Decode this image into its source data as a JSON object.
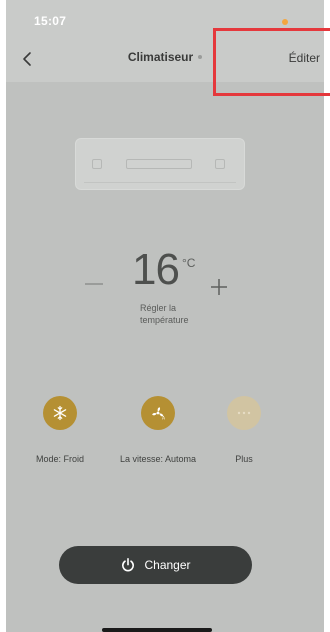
{
  "status_bar": {
    "time": "15:07"
  },
  "navbar": {
    "title": "Climatiseur",
    "edit_label": "Éditer",
    "back_icon": "chevron-left-icon"
  },
  "temperature": {
    "value": "16",
    "unit": "°C",
    "label_line1": "Régler la",
    "label_line2": "température"
  },
  "controls": [
    {
      "label": "Mode: Froid",
      "icon": "snowflake-icon"
    },
    {
      "label": "La vitesse: Automa",
      "icon": "fan-icon"
    },
    {
      "label": "Plus",
      "icon": "more-icon"
    }
  ],
  "power_button": {
    "label": "Changer",
    "icon": "power-icon"
  },
  "colors": {
    "overlay_bg": "#bfc1bf",
    "accent_gold": "#b59033",
    "button_dark": "#3a3d3c",
    "highlight": "#e5383c"
  }
}
